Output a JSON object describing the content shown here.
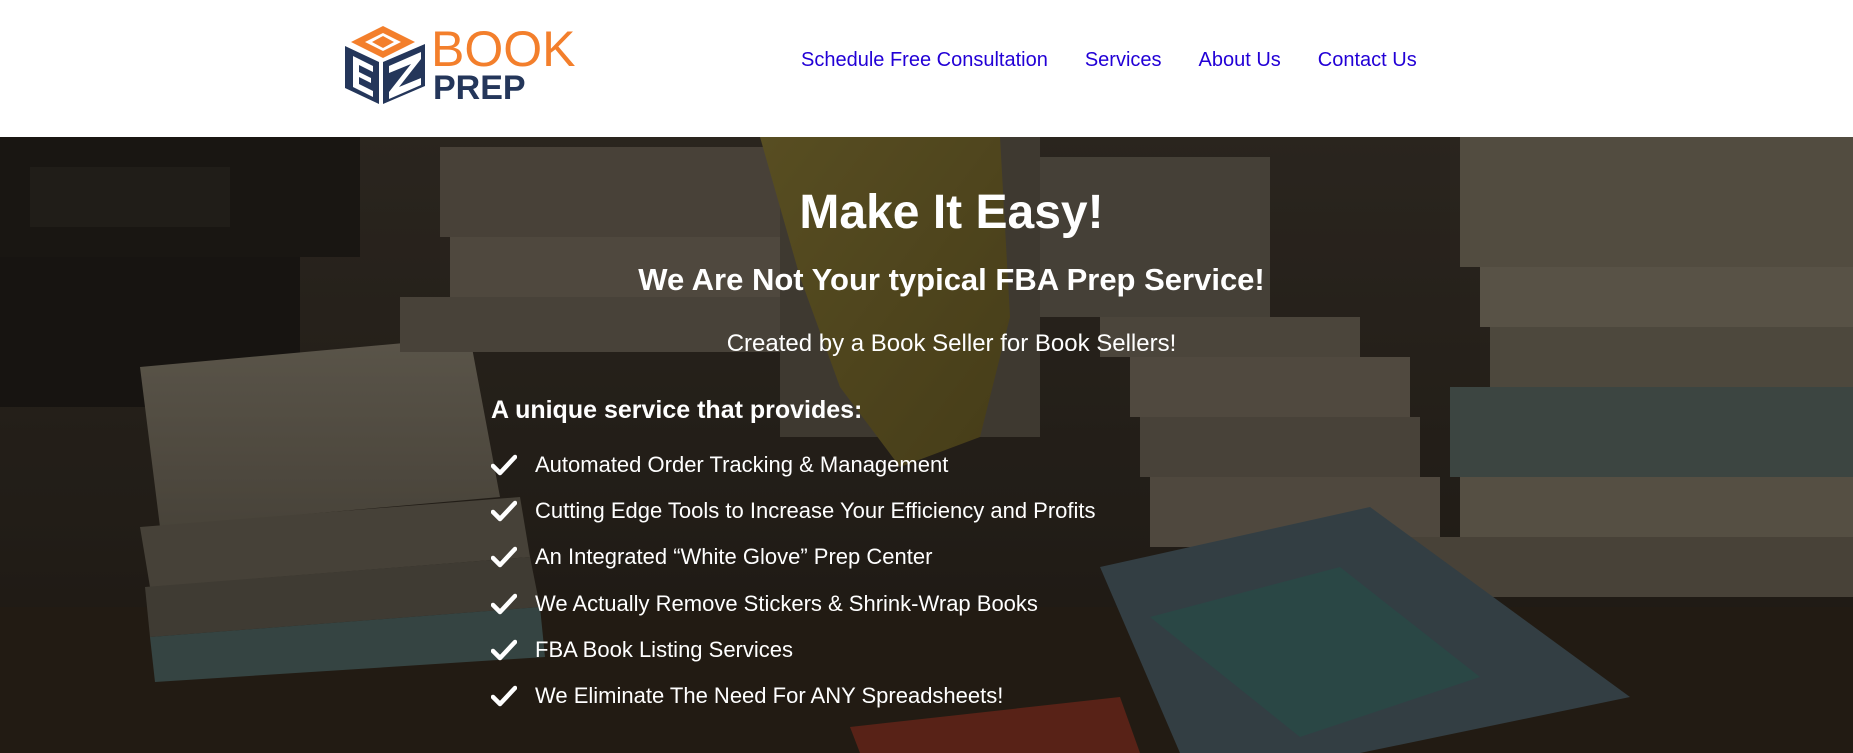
{
  "brand": {
    "logo_letters": "EZ",
    "logo_word_top": "BOOK",
    "logo_word_bottom": "PREP",
    "colors": {
      "orange": "#f37f2c",
      "navy": "#24365a",
      "nav_link": "#2200d6"
    }
  },
  "nav": {
    "items": [
      {
        "label": "Schedule Free Consultation"
      },
      {
        "label": "Services"
      },
      {
        "label": "About Us"
      },
      {
        "label": "Contact Us"
      }
    ]
  },
  "hero": {
    "title": "Make It Easy!",
    "subtitle": "We Are Not Your typical FBA Prep Service!",
    "tagline": "Created by a Book Seller for Book Sellers!",
    "list_heading": "A unique service that provides:",
    "list_icon": "check-icon",
    "features": [
      "Automated Order Tracking & Management",
      "Cutting Edge Tools to Increase Your Efficiency and Profits",
      "An Integrated “White Glove” Prep Center",
      "We Actually Remove Stickers & Shrink-Wrap Books",
      "FBA Book Listing Services",
      "We Eliminate The Need For ANY Spreadsheets!"
    ]
  }
}
